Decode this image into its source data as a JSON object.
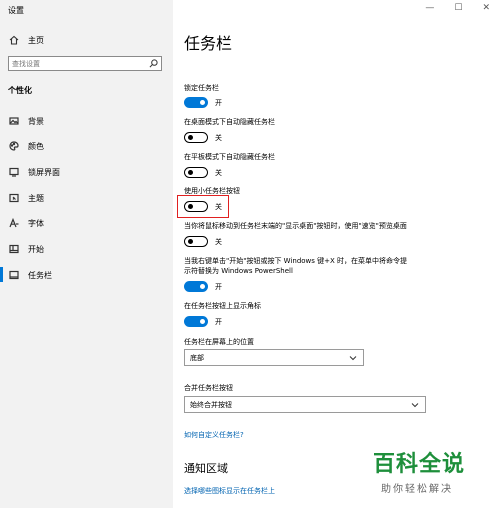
{
  "window": {
    "title": "设置",
    "minimize": "—",
    "maximize": "☐",
    "close": "✕"
  },
  "sidebar": {
    "home": "主页",
    "search_placeholder": "查找设置",
    "section": "个性化",
    "items": [
      {
        "label": "背景",
        "icon": "image-icon"
      },
      {
        "label": "颜色",
        "icon": "palette-icon"
      },
      {
        "label": "锁屏界面",
        "icon": "lock-screen-icon"
      },
      {
        "label": "主题",
        "icon": "theme-icon"
      },
      {
        "label": "字体",
        "icon": "font-icon"
      },
      {
        "label": "开始",
        "icon": "start-icon"
      },
      {
        "label": "任务栏",
        "icon": "taskbar-icon"
      }
    ],
    "selected": "任务栏"
  },
  "main": {
    "title": "任务栏",
    "settings": [
      {
        "label": "锁定任务栏",
        "state": "开",
        "on": true
      },
      {
        "label": "在桌面模式下自动隐藏任务栏",
        "state": "关",
        "on": false
      },
      {
        "label": "在平板模式下自动隐藏任务栏",
        "state": "关",
        "on": false
      },
      {
        "label": "使用小任务栏按钮",
        "state": "关",
        "on": false
      },
      {
        "label": "当你将鼠标移动到任务栏末端的\"显示桌面\"按钮时，使用\"速览\"预览桌面",
        "state": "关",
        "on": false
      },
      {
        "label1": "当我右键单击\"开始\"按钮或按下 Windows 键+X 时，在菜单中将命令提",
        "label2": "示符替换为 Windows PowerShell",
        "state": "开",
        "on": true
      },
      {
        "label": "在任务栏按钮上显示角标",
        "state": "开",
        "on": true
      }
    ],
    "position": {
      "label": "任务栏在屏幕上的位置",
      "value": "底部"
    },
    "combine": {
      "label": "合并任务栏按钮",
      "value": "始终合并按钮"
    },
    "customize_link": "如何自定义任务栏?",
    "notify_heading": "通知区域",
    "notify_link": "选择哪些图标显示在任务栏上"
  },
  "watermark": {
    "main": "百科全说",
    "sub": "助你轻松解决"
  },
  "colors": {
    "accent": "#0078d7",
    "highlight": "#e02020",
    "link": "#0063b1",
    "watermark": "#1e8f3b"
  }
}
